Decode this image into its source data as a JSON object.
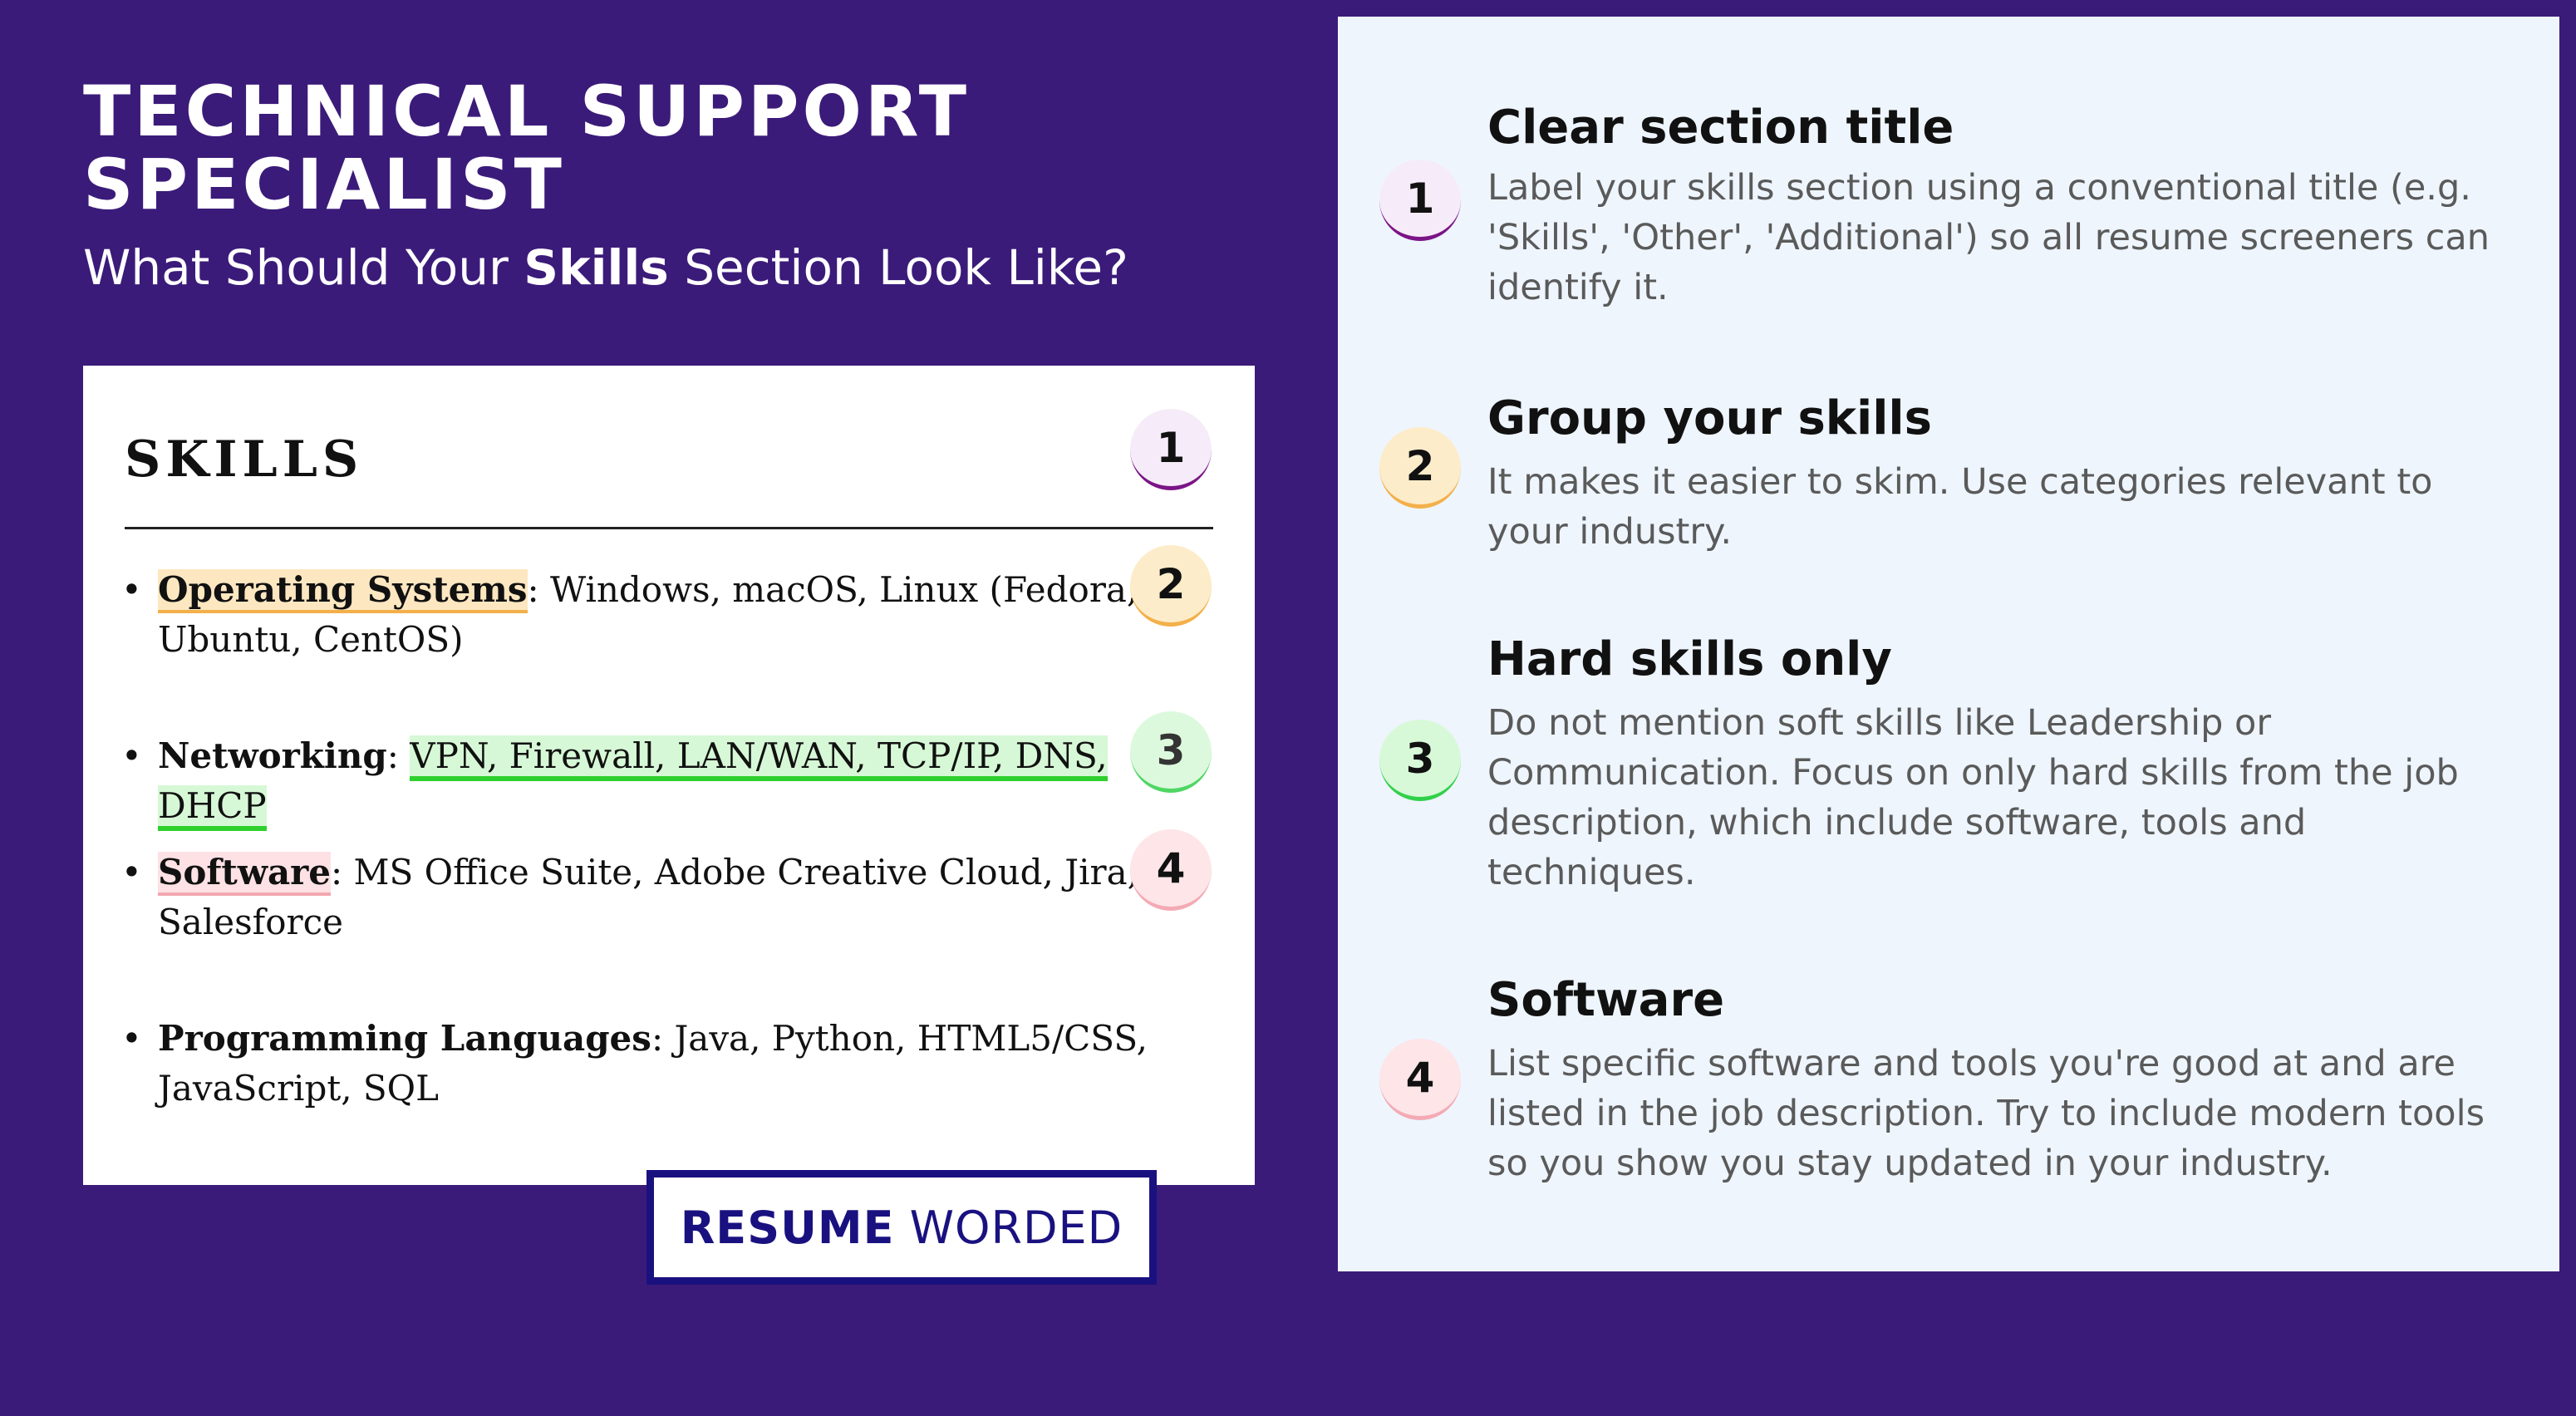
{
  "header": {
    "title": "TECHNICAL SUPPORT SPECIALIST",
    "subtitle_pre": "What Should Your ",
    "subtitle_bold": "Skills",
    "subtitle_post": " Section Look Like?"
  },
  "resume": {
    "section_title": "SKILLS",
    "items": [
      {
        "category": "Operating Systems",
        "separator": ":",
        "text": " Windows, macOS, Linux (Fedora, Ubuntu, CentOS)"
      },
      {
        "category": "Networking",
        "separator": ": ",
        "text": "VPN, Firewall, LAN/WAN, TCP/IP, DNS, DHCP"
      },
      {
        "category": "Software",
        "separator": ":",
        "text": " MS Office Suite, Adobe Creative Cloud, Jira, Salesforce"
      },
      {
        "category": "Programming Languages",
        "separator": ":",
        "text": " Java, Python, HTML5/CSS, JavaScript, SQL"
      }
    ],
    "badges": [
      "1",
      "2",
      "3",
      "4"
    ]
  },
  "logo": {
    "bold": "RESUME",
    "regular": "WORDED"
  },
  "tips": [
    {
      "number": "1",
      "title": "Clear section title",
      "body": "Label your skills section using a conventional title (e.g. 'Skills', 'Other', 'Additional') so all resume screeners can identify it."
    },
    {
      "number": "2",
      "title": "Group your skills",
      "body": "It makes it easier to skim. Use categories relevant to your industry."
    },
    {
      "number": "3",
      "title": "Hard skills only",
      "body": "Do not mention soft skills like Leadership or Communication. Focus on only hard skills from the job description, which include software, tools and techniques."
    },
    {
      "number": "4",
      "title": "Software",
      "body": "List specific software and tools you're good at and are listed in the job description. Try to include modern tools so you show you stay updated in your industry."
    }
  ],
  "colors": {
    "background": "#3b1b79",
    "panel": "#eef5fd",
    "logo_blue": "#1a1180",
    "badge_1_accent": "#7b1486",
    "badge_2_accent": "#f3b04a",
    "badge_3_accent": "#31d04a",
    "badge_4_accent": "#f4aab4"
  }
}
